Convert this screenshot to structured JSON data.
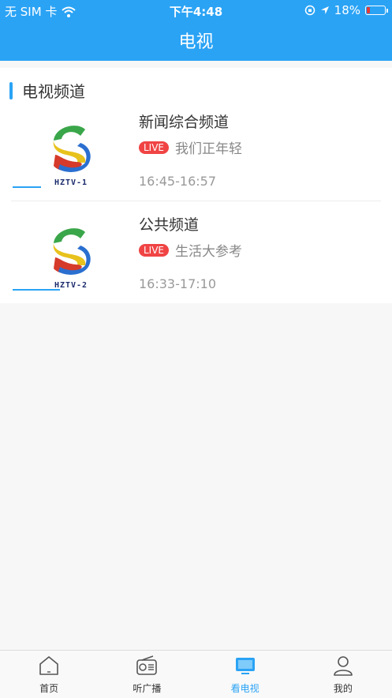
{
  "status_bar": {
    "carrier": "无 SIM 卡",
    "time": "下午4:48",
    "battery": "18%",
    "battery_level": 0.18
  },
  "header": {
    "title": "电视"
  },
  "section": {
    "title": "电视频道"
  },
  "channels": [
    {
      "logo_text": "HZTV-1",
      "name": "新闻综合频道",
      "live_badge": "LIVE",
      "program": "我们正年轻",
      "time": "16:45-16:57"
    },
    {
      "logo_text": "HZTV-2",
      "name": "公共频道",
      "live_badge": "LIVE",
      "program": "生活大参考",
      "time": "16:33-17:10"
    }
  ],
  "tabbar": {
    "tabs": [
      {
        "label": "首页",
        "icon": "home-icon"
      },
      {
        "label": "听广播",
        "icon": "radio-icon"
      },
      {
        "label": "看电视",
        "icon": "tv-icon"
      },
      {
        "label": "我的",
        "icon": "user-icon"
      }
    ],
    "active_index": 2
  },
  "colors": {
    "accent": "#2aa3f5",
    "live": "#f04444",
    "battery_low": "#e53935"
  }
}
